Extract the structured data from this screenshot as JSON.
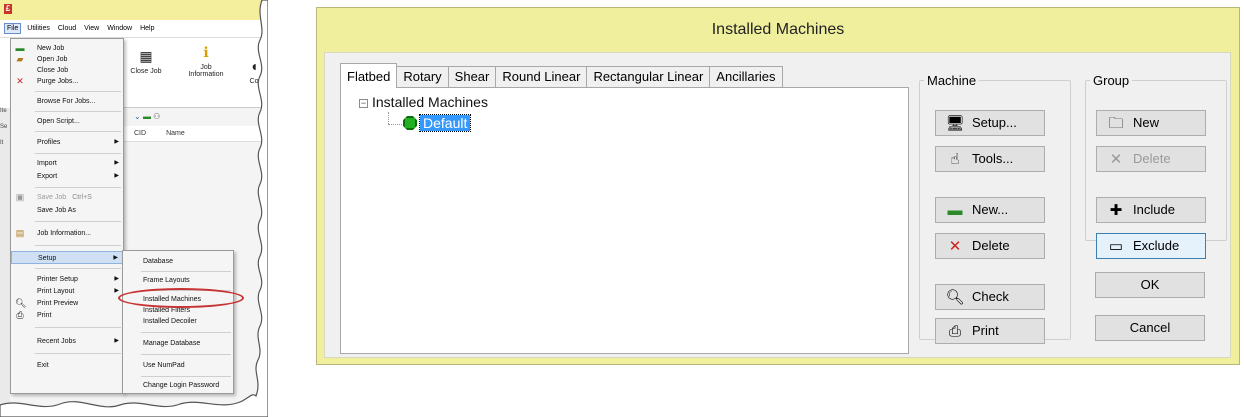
{
  "app": {
    "menubar": [
      "File",
      "Utilities",
      "Cloud",
      "View",
      "Window",
      "Help"
    ],
    "ribbon": [
      {
        "label": "Close Job",
        "icon": "close-job-icon"
      },
      {
        "label": "Job Information",
        "icon": "job-information-icon"
      },
      {
        "label": "Co",
        "icon": "cut-off-icon"
      }
    ],
    "columns": [
      "CID",
      "Name"
    ],
    "left_letters": [
      "Ite",
      "Se",
      "It"
    ],
    "file_menu": [
      {
        "label": "New Job",
        "icon": "new-job-icon"
      },
      {
        "label": "Open Job",
        "icon": "open-job-icon"
      },
      {
        "label": "Close Job",
        "icon": ""
      },
      {
        "label": "Purge Jobs...",
        "icon": "purge-icon"
      },
      {
        "label": "Browse For Jobs...",
        "icon": ""
      },
      {
        "label": "Open Script...",
        "icon": ""
      },
      {
        "label": "Profiles",
        "icon": "",
        "submenu": true
      },
      {
        "label": "Import",
        "icon": "",
        "submenu": true
      },
      {
        "label": "Export",
        "icon": "",
        "submenu": true
      },
      {
        "label": "Save Job",
        "shortcut": "Ctrl+S",
        "icon": "save-icon",
        "disabled": true
      },
      {
        "label": "Save Job As",
        "icon": ""
      },
      {
        "label": "Job Information...",
        "icon": "job-information-icon"
      },
      {
        "label": "Setup",
        "icon": "",
        "submenu": true,
        "highlighted": true
      },
      {
        "label": "Printer Setup",
        "icon": "",
        "submenu": true
      },
      {
        "label": "Print Layout",
        "icon": "",
        "submenu": true
      },
      {
        "label": "Print Preview",
        "icon": "print-preview-icon"
      },
      {
        "label": "Print",
        "icon": "print-icon"
      },
      {
        "label": "Recent Jobs",
        "icon": "",
        "submenu": true
      },
      {
        "label": "Exit",
        "icon": ""
      }
    ],
    "setup_submenu": [
      "Database",
      "Frame Layouts",
      "Installed Machines",
      "Installed Filters",
      "Installed Decoiler",
      "Manage Database",
      "Use NumPad",
      "Change Login Password"
    ]
  },
  "dialog": {
    "title": "Installed Machines",
    "tabs": [
      "Flatbed",
      "Rotary",
      "Shear",
      "Round Linear",
      "Rectangular Linear",
      "Ancillaries"
    ],
    "active_tab": "Flatbed",
    "tree": {
      "root": "Installed Machines",
      "children": [
        "Default"
      ]
    },
    "machine_group": {
      "label": "Machine",
      "buttons": [
        "Setup...",
        "Tools...",
        "New...",
        "Delete",
        "Check",
        "Print"
      ]
    },
    "group_group": {
      "label": "Group",
      "buttons": [
        "New",
        "Delete",
        "Include",
        "Exclude"
      ]
    },
    "ok_label": "OK",
    "cancel_label": "Cancel"
  }
}
